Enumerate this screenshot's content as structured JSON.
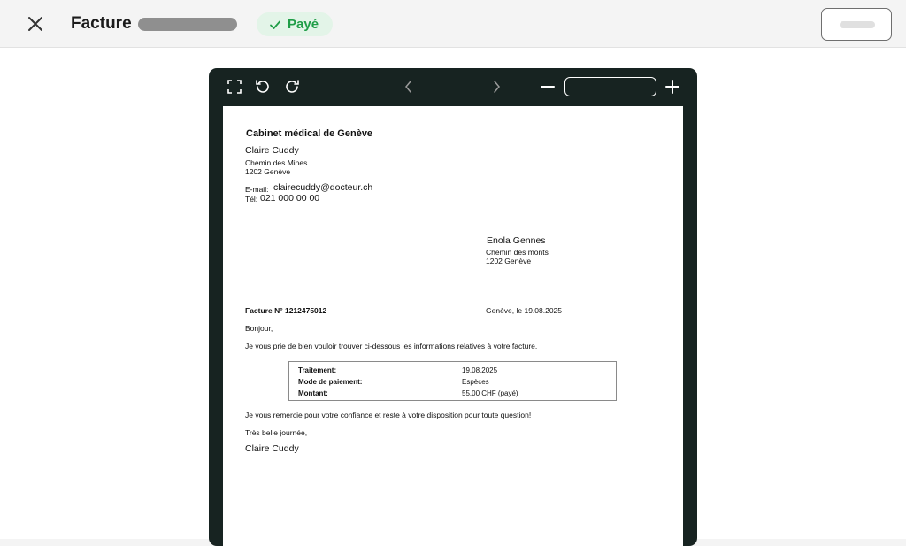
{
  "header": {
    "title": "Facture",
    "status": "Payé"
  },
  "colors": {
    "status_bg": "#e3f4e8",
    "status_fg": "#1f9d47",
    "viewer_bg": "#172321"
  },
  "icons": [
    "close-icon",
    "check-icon",
    "fullscreen-icon",
    "rotate-left-icon",
    "rotate-right-icon",
    "chevron-left-icon",
    "chevron-right-icon",
    "zoom-out-icon",
    "zoom-in-icon"
  ],
  "viewer": {
    "zoom_value": ""
  },
  "document": {
    "cabinet": "Cabinet médical de Genève",
    "sender": {
      "name": "Claire Cuddy",
      "street": "Chemin des Mines",
      "city": "1202 Genève",
      "email_label": "E-mail:",
      "email": "clairecuddy@docteur.ch",
      "phone_label": "Tél:",
      "phone": "021 000 00 00"
    },
    "recipient": {
      "name": "Enola Gennes",
      "street": "Chemin des monts",
      "city": "1202 Genève"
    },
    "invoice_number": "Facture N° 1212475012",
    "place_date": "Genève, le 19.08.2025",
    "greeting": "Bonjour,",
    "intro": "Je vous prie de bien vouloir trouver ci-dessous les informations relatives à votre facture.",
    "details": [
      {
        "label": "Traitement:",
        "value": "19.08.2025"
      },
      {
        "label": "Mode de paiement:",
        "value": "Espèces"
      },
      {
        "label": "Montant:",
        "value": "55.00 CHF (payé)"
      }
    ],
    "thanks": "Je vous remercie pour votre confiance et reste à votre disposition pour toute question!",
    "closing": "Très belle journée,",
    "signature": "Claire Cuddy"
  }
}
